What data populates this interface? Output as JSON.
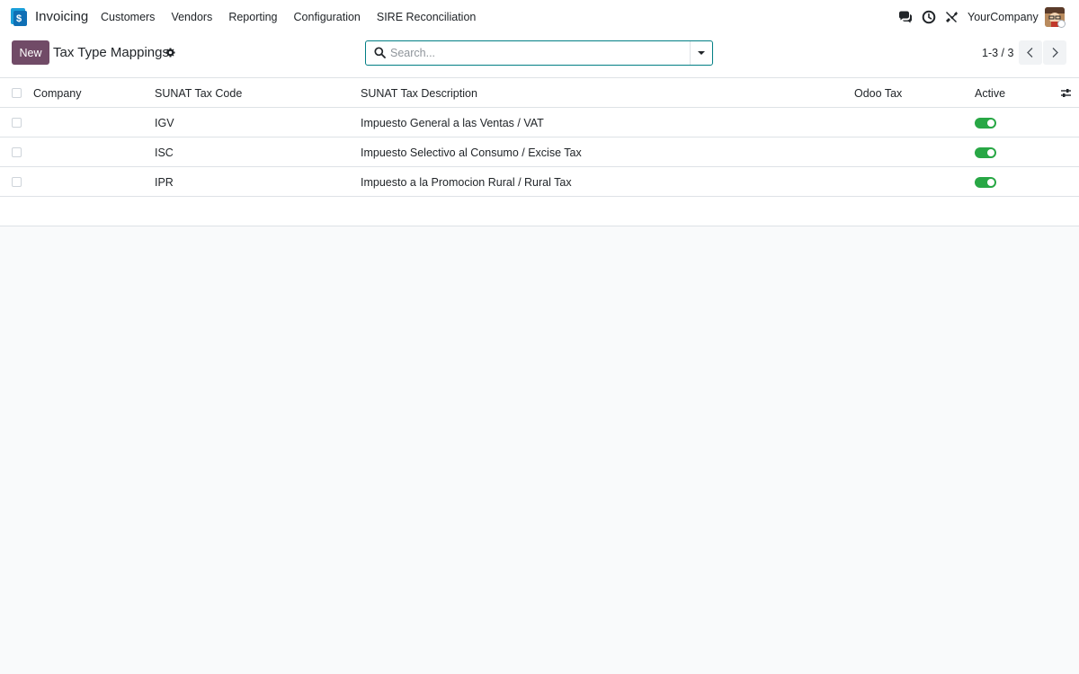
{
  "navbar": {
    "app_name": "Invoicing",
    "menu": [
      "Customers",
      "Vendors",
      "Reporting",
      "Configuration",
      "SIRE Reconciliation"
    ],
    "company": "YourCompany"
  },
  "control_panel": {
    "new_label": "New",
    "title": "Tax Type Mappings",
    "search_placeholder": "Search...",
    "pager": "1-3 / 3"
  },
  "table": {
    "columns": [
      "Company",
      "SUNAT Tax Code",
      "SUNAT Tax Description",
      "Odoo Tax",
      "Active"
    ],
    "rows": [
      {
        "company": "",
        "code": "IGV",
        "description": "Impuesto General a las Ventas / VAT",
        "odoo_tax": "",
        "active": true
      },
      {
        "company": "",
        "code": "ISC",
        "description": "Impuesto Selectivo al Consumo / Excise Tax",
        "odoo_tax": "",
        "active": true
      },
      {
        "company": "",
        "code": "IPR",
        "description": "Impuesto a la Promocion Rural / Rural Tax",
        "odoo_tax": "",
        "active": true
      }
    ]
  },
  "colors": {
    "brand": "#714b67",
    "search_border": "#017e84",
    "toggle_on": "#28a745"
  }
}
